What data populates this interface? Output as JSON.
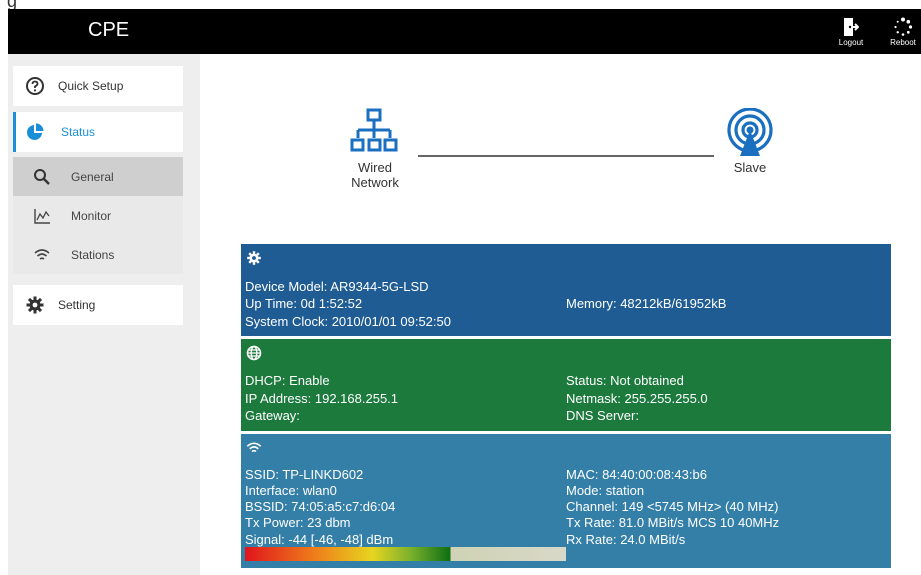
{
  "header": {
    "brand": "CPE",
    "logout_label": "Logout",
    "reboot_label": "Reboot"
  },
  "sidebar": {
    "quick_setup": "Quick Setup",
    "status": "Status",
    "sub": {
      "general": "General",
      "monitor": "Monitor",
      "stations": "Stations"
    },
    "setting": "Setting"
  },
  "topology": {
    "left_line1": "Wired",
    "left_line2": "Network",
    "right": "Slave"
  },
  "device": {
    "model_key": "Device Model:",
    "model_val": "AR9344-5G-LSD",
    "uptime_key": "Up Time:",
    "uptime_val": "0d 1:52:52",
    "clock_key": "System Clock:",
    "clock_val": "2010/01/01 09:52:50",
    "memory_key": "Memory:",
    "memory_val": "48212kB/61952kB"
  },
  "network": {
    "dhcp_key": "DHCP:",
    "dhcp_val": "Enable",
    "ip_key": "IP Address:",
    "ip_val": "192.168.255.1",
    "gateway_key": "Gateway:",
    "gateway_val": "",
    "status_key": "Status:",
    "status_val": "Not obtained",
    "netmask_key": "Netmask:",
    "netmask_val": "255.255.255.0",
    "dns_key": "DNS Server:",
    "dns_val": ""
  },
  "wireless": {
    "ssid_key": "SSID:",
    "ssid_val": "TP-LINKD602",
    "iface_key": "Interface:",
    "iface_val": "wlan0",
    "bssid_key": "BSSID:",
    "bssid_val": "74:05:a5:c7:d6:04",
    "txpower_key": "Tx Power:",
    "txpower_val": "23 dbm",
    "signal_key": "Signal:",
    "signal_val": "-44 [-46, -48] dBm",
    "mac_key": "MAC:",
    "mac_val": "84:40:00:08:43:b6",
    "mode_key": "Mode:",
    "mode_val": "station",
    "channel_key": "Channel:",
    "channel_val": "149 <5745 MHz> (40 MHz)",
    "txrate_key": "Tx Rate:",
    "txrate_val": "81.0 MBit/s MCS 10 40MHz",
    "rxrate_key": "Rx Rate:",
    "rxrate_val": "24.0 MBit/s",
    "signal_level_fraction": 0.64
  },
  "colors": {
    "device_panel": "#1f5c93",
    "network_panel": "#1c7a3d",
    "wireless_panel": "#347fa8",
    "accent": "#1a8fd8"
  }
}
